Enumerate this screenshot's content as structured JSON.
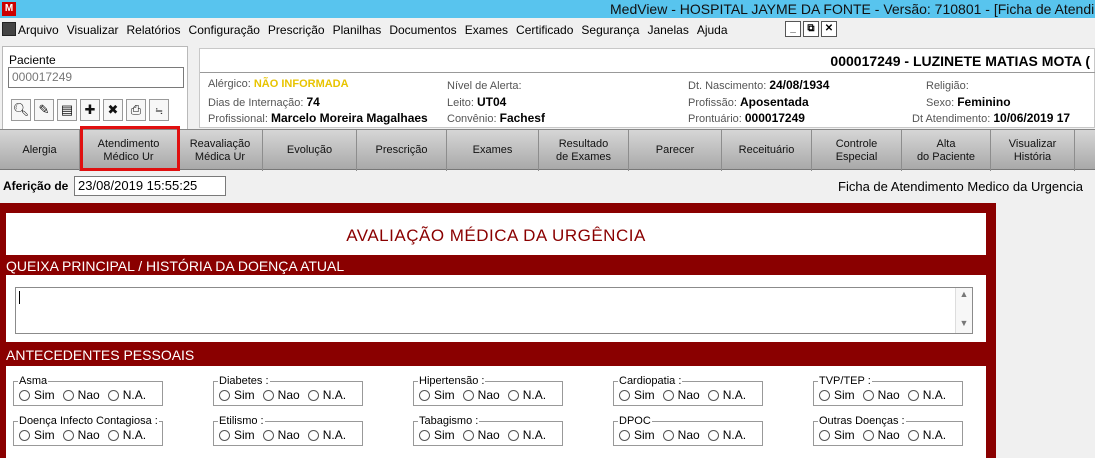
{
  "window": {
    "title": "MedView - HOSPITAL JAYME DA FONTE - Versão: 710801 - [Ficha de Atendim"
  },
  "menu": [
    "Arquivo",
    "Visualizar",
    "Relatórios",
    "Configuração",
    "Prescrição",
    "Planilhas",
    "Documentos",
    "Exames",
    "Certificado",
    "Segurança",
    "Janelas",
    "Ajuda"
  ],
  "window_controls": [
    "_",
    "⧉",
    "✕"
  ],
  "patient": {
    "label": "Paciente",
    "value": "000017249"
  },
  "header": {
    "patient_name": "000017249 - LUZINETE MATIAS MOTA (",
    "alergico_label": "Alérgico:",
    "alergico_value": "NÃO INFORMADA",
    "dias_label": "Dias de Internação:",
    "dias_value": "74",
    "profissional_label": "Profissional:",
    "profissional_value": "Marcelo Moreira Magalhaes",
    "nivel_label": "Nível de Alerta:",
    "nivel_value": "",
    "leito_label": "Leito:",
    "leito_value": "UT04",
    "convenio_label": "Convênio:",
    "convenio_value": "Fachesf",
    "nasc_label": "Dt. Nascimento:",
    "nasc_value": "24/08/1934",
    "profissao_label": "Profissão:",
    "profissao_value": "Aposentada",
    "prontuario_label": "Prontuário:",
    "prontuario_value": "000017249",
    "religiao_label": "Religião:",
    "religiao_value": "",
    "sexo_label": "Sexo:",
    "sexo_value": "Feminino",
    "atend_label": "Dt Atendimento:",
    "atend_value": "10/06/2019 17"
  },
  "tabs": [
    "Alergia",
    "Atendimento\nMédico Ur",
    "Reavaliação\nMédica Ur",
    "Evolução",
    "Prescrição",
    "Exames",
    "Resultado\nde Exames",
    "Parecer",
    "Receituário",
    "Controle\nEspecial",
    "Alta\ndo Paciente",
    "Visualizar\nHistória"
  ],
  "afericao": {
    "label": "Aferição de",
    "value": "23/08/2019 15:55:25"
  },
  "ficha_title": "Ficha de Atendimento Medico da Urgencia",
  "form": {
    "title": "AVALIAÇÃO MÉDICA DA URGÊNCIA",
    "queixa_header": "QUEIXA PRINCIPAL / HISTÓRIA DA DOENÇA ATUAL",
    "antecedentes_header": "ANTECEDENTES PESSOAIS",
    "options": [
      "Sim",
      "Nao",
      "N.A."
    ],
    "groups": [
      {
        "label": "Asma"
      },
      {
        "label": "Diabetes :"
      },
      {
        "label": "Hipertensão :"
      },
      {
        "label": "Cardiopatia :"
      },
      {
        "label": "TVP/TEP :"
      },
      {
        "label": "Doença Infecto Contagiosa :"
      },
      {
        "label": "Etilismo :"
      },
      {
        "label": "Tabagismo :"
      },
      {
        "label": "DPOC"
      },
      {
        "label": "Outras Doenças :"
      }
    ]
  }
}
